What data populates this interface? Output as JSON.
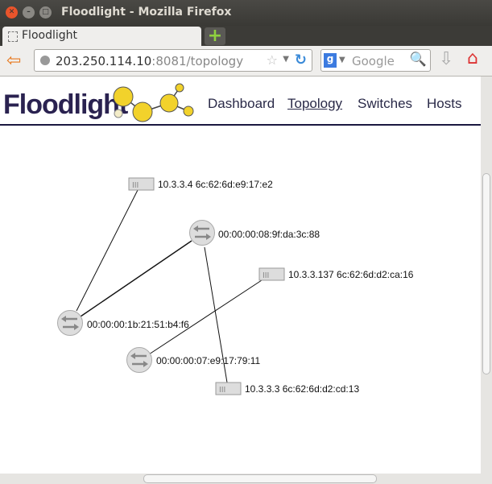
{
  "window": {
    "title": "Floodlight - Mozilla Firefox"
  },
  "tab": {
    "label": "Floodlight",
    "new_tab": "+"
  },
  "urlbar": {
    "host": "203.250.114.10",
    "rest": ":8081/topology"
  },
  "search": {
    "placeholder": "Google"
  },
  "app": {
    "logo": "Floodlight",
    "nav": [
      "Dashboard",
      "Topology",
      "Switches",
      "Hosts"
    ],
    "active_nav": "Topology"
  },
  "topology": {
    "switches": [
      {
        "id": "00:00:00:08:9f:da:3c:88"
      },
      {
        "id": "00:00:00:1b:21:51:b4:f6"
      },
      {
        "id": "00:00:00:07:e9:17:79:11"
      }
    ],
    "hosts": [
      {
        "label": "10.3.3.4 6c:62:6d:e9:17:e2"
      },
      {
        "label": "10.3.3.137 6c:62:6d:d2:ca:16"
      },
      {
        "label": "10.3.3.3 6c:62:6d:d2:cd:13"
      }
    ],
    "links": [
      [
        "host:0",
        "switch:1"
      ],
      [
        "switch:0",
        "switch:1"
      ],
      [
        "switch:0",
        "host:2"
      ],
      [
        "host:1",
        "switch:2"
      ]
    ]
  }
}
